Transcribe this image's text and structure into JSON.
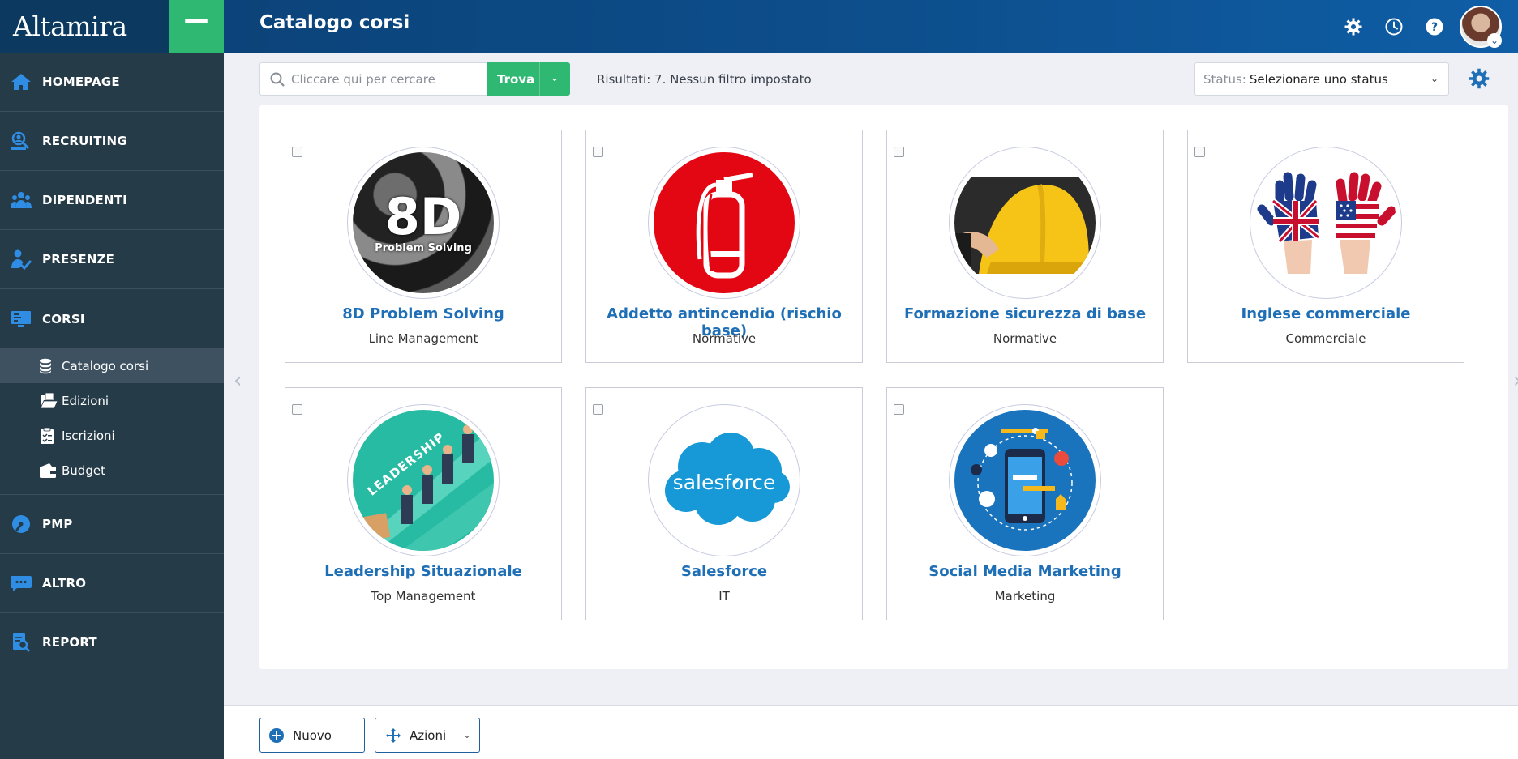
{
  "app": {
    "logo": "Altamira",
    "page_title": "Catalogo corsi"
  },
  "sidebar": {
    "items": [
      {
        "label": "HOMEPAGE",
        "icon": "home-icon"
      },
      {
        "label": "RECRUITING",
        "icon": "recruiting-search-icon"
      },
      {
        "label": "DIPENDENTI",
        "icon": "users-group-icon"
      },
      {
        "label": "PRESENZE",
        "icon": "attendance-icon"
      },
      {
        "label": "CORSI",
        "icon": "monitor-course-icon"
      },
      {
        "label": "PMP",
        "icon": "gauge-icon"
      },
      {
        "label": "ALTRO",
        "icon": "chat-bubble-icon"
      },
      {
        "label": "REPORT",
        "icon": "report-search-icon"
      }
    ],
    "corsi_sub": [
      {
        "label": "Catalogo corsi",
        "icon": "database-icon",
        "active": true
      },
      {
        "label": "Edizioni",
        "icon": "folder-open-icon"
      },
      {
        "label": "Iscrizioni",
        "icon": "clipboard-check-icon"
      },
      {
        "label": "Budget",
        "icon": "wallet-icon"
      }
    ]
  },
  "toolbar": {
    "search_placeholder": "Cliccare qui per cercare",
    "find_label": "Trova",
    "results_text": "Risultati: 7. Nessun filtro impostato",
    "status_prefix": "Status:",
    "status_value": "Selezionare uno status"
  },
  "courses": [
    {
      "title": "8D Problem Solving",
      "category": "Line Management",
      "image_text": "8D",
      "image_subtext": "Problem Solving"
    },
    {
      "title": "Addetto antincendio (rischio base)",
      "category": "Normative"
    },
    {
      "title": "Formazione sicurezza di base",
      "category": "Normative"
    },
    {
      "title": "Inglese commerciale",
      "category": "Commerciale"
    },
    {
      "title": "Leadership Situazionale",
      "category": "Top Management",
      "image_text": "LEADERSHIP"
    },
    {
      "title": "Salesforce",
      "category": "IT",
      "image_text": "salesforce"
    },
    {
      "title": "Social Media Marketing",
      "category": "Marketing"
    }
  ],
  "bottom": {
    "new_label": "Nuovo",
    "actions_label": "Azioni"
  },
  "colors": {
    "topbar": "#0d4f8d",
    "green": "#2eb872",
    "sidebar": "#263b48",
    "link_blue": "#1f6fb6"
  }
}
